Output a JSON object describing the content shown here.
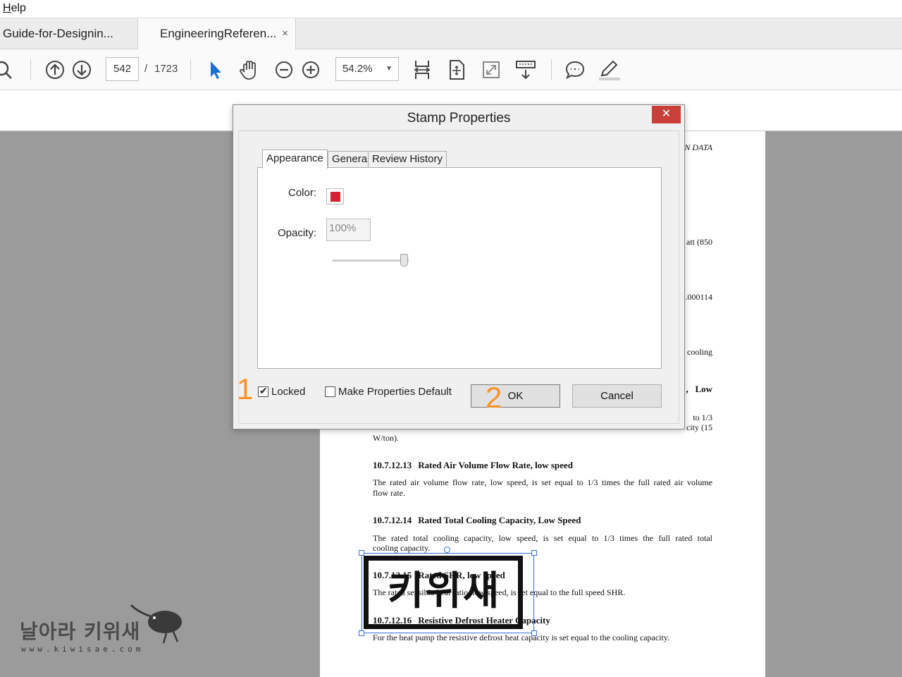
{
  "menu": {
    "help": "Help",
    "help_underline": "H",
    "help_rest": "elp"
  },
  "tabs": [
    {
      "label": "Guide-for-Designin..."
    },
    {
      "label": "EngineeringReferen...",
      "close": "×"
    }
  ],
  "toolbar": {
    "page_current": "542",
    "page_sep": "/",
    "page_total": "1723",
    "zoom": "54.2%",
    "zoom_arrow": "▼"
  },
  "pdf": {
    "header_right": "N DATA",
    "right_fragments": [
      "att (850",
      ".000114",
      "cooling",
      ",   Low",
      "to 1/3",
      "city (15"
    ],
    "w_ton": "W/ton).",
    "sections": [
      {
        "num": "10.7.12.13",
        "title": "Rated Air Volume Flow Rate, low speed",
        "body1": "The rated air volume flow rate, low speed, is set equal to 1/3 times the full rated air volume",
        "body2": "flow rate."
      },
      {
        "num": "10.7.12.14",
        "title": "Rated Total Cooling Capacity, Low Speed",
        "body1": "The rated total cooling capacity, low speed, is set equal to 1/3 times the full rated total",
        "body2": "cooling capacity."
      },
      {
        "num": "10.7.12.15",
        "title": "Rated SHR, low speed",
        "body1": "The rated sensible heat ratio, low speed, is set equal to the full speed SHR."
      },
      {
        "num": "10.7.12.16",
        "title": "Resistive Defrost Heater Capacity",
        "body1": "For the heat pump the resistive defrost heat capacity is set equal to the cooling capacity."
      }
    ]
  },
  "stamp": {
    "text": "키위새"
  },
  "watermark": {
    "text": "날아라 키위새",
    "url": "www.kiwisae.com"
  },
  "dialog": {
    "title": "Stamp Properties",
    "close": "✕",
    "tabs": [
      "Appearance",
      "General",
      "Review History"
    ],
    "color_label": "Color:",
    "color_value": "#d42032",
    "opacity_label": "Opacity:",
    "opacity_value": "100%",
    "locked_label": "Locked",
    "locked_checked": true,
    "make_default_label": "Make Properties Default",
    "make_default_checked": false,
    "ok_label": "OK",
    "cancel_label": "Cancel"
  },
  "annotations": {
    "step1": "1",
    "step2": "2"
  }
}
